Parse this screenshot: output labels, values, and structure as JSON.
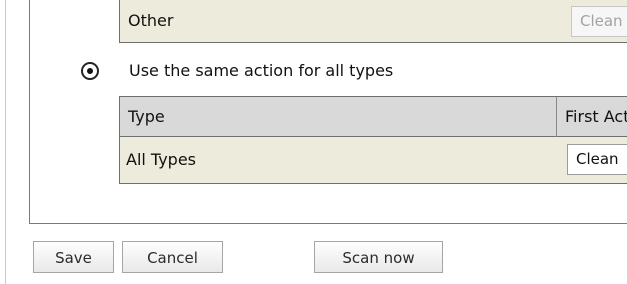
{
  "scan_action_panel": {
    "top_table": {
      "row_other": {
        "type_label": "Other",
        "action_value": "Clean"
      }
    },
    "same_action": {
      "radio_checked": true,
      "label": "Use the same action for all types"
    },
    "bottom_table": {
      "headers": {
        "type": "Type",
        "first_action": "First Act"
      },
      "rows": [
        {
          "type": "All Types",
          "action": "Clean"
        }
      ]
    }
  },
  "buttons": {
    "save": "Save",
    "cancel": "Cancel",
    "scan_now": "Scan now"
  }
}
